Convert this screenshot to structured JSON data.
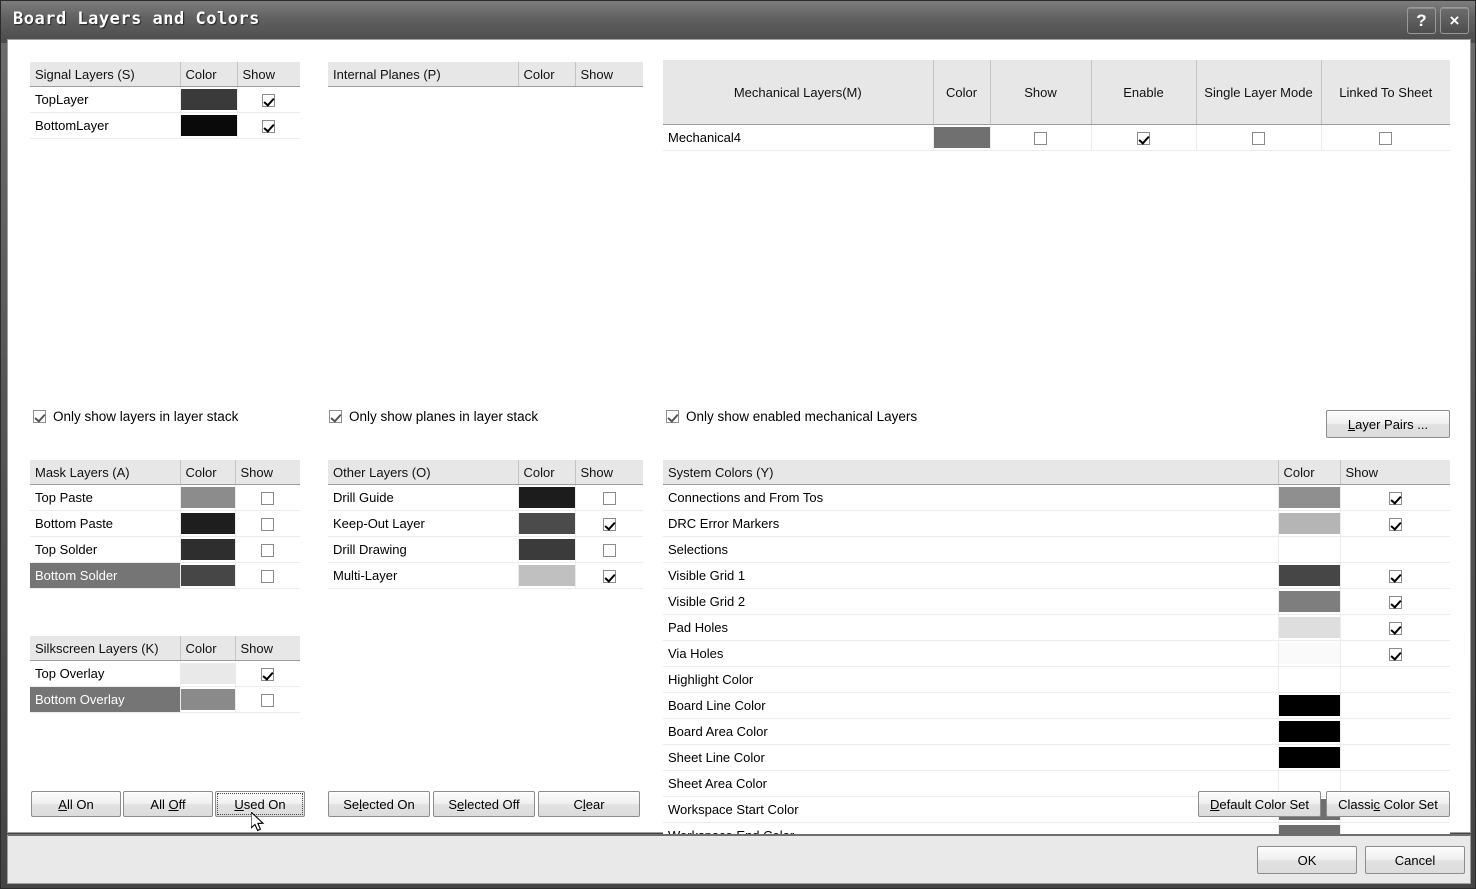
{
  "window": {
    "title": "Board Layers and Colors",
    "help_button": "?",
    "close_button": "×"
  },
  "signal_layers": {
    "headers": [
      "Signal Layers (S)",
      "Color",
      "Show"
    ],
    "rows": [
      {
        "name": "TopLayer",
        "color": "#3a3a3a",
        "show": true,
        "selected": false
      },
      {
        "name": "BottomLayer",
        "color": "#0a0a0a",
        "show": true,
        "selected": false
      }
    ]
  },
  "internal_planes": {
    "headers": [
      "Internal Planes (P)",
      "Color",
      "Show"
    ],
    "rows": []
  },
  "mechanical_layers": {
    "headers": [
      "Mechanical Layers(M)",
      "Color",
      "Show",
      "Enable",
      "Single Layer Mode",
      "Linked To Sheet"
    ],
    "rows": [
      {
        "name": "Mechanical4",
        "color": "#707070",
        "show": false,
        "enable": true,
        "single_layer_mode": false,
        "linked_to_sheet": false,
        "selected": false
      }
    ]
  },
  "options": {
    "only_show_layers": {
      "label": "Only show layers in layer stack",
      "checked": true
    },
    "only_show_planes": {
      "label": "Only show planes in layer stack",
      "checked": true
    },
    "only_show_mechanical": {
      "label": "Only show enabled mechanical Layers",
      "checked": true
    }
  },
  "mask_layers": {
    "headers": [
      "Mask Layers (A)",
      "Color",
      "Show"
    ],
    "rows": [
      {
        "name": "Top Paste",
        "color": "#8c8c8c",
        "show": false,
        "selected": false
      },
      {
        "name": "Bottom Paste",
        "color": "#1e1e1e",
        "show": false,
        "selected": false
      },
      {
        "name": "Top Solder",
        "color": "#2e2e2e",
        "show": false,
        "selected": false
      },
      {
        "name": "Bottom Solder",
        "color": "#464646",
        "show": false,
        "selected": true
      }
    ]
  },
  "other_layers": {
    "headers": [
      "Other Layers (O)",
      "Color",
      "Show"
    ],
    "rows": [
      {
        "name": "Drill Guide",
        "color": "#1c1c1c",
        "show": false,
        "selected": false
      },
      {
        "name": "Keep-Out Layer",
        "color": "#4b4b4b",
        "show": true,
        "selected": false
      },
      {
        "name": "Drill Drawing",
        "color": "#3b3b3b",
        "show": false,
        "selected": false
      },
      {
        "name": "Multi-Layer",
        "color": "#c0c0c0",
        "show": true,
        "selected": false
      }
    ]
  },
  "silkscreen_layers": {
    "headers": [
      "Silkscreen Layers (K)",
      "Color",
      "Show"
    ],
    "rows": [
      {
        "name": "Top Overlay",
        "color": "#e9e9e9",
        "show": true,
        "selected": false
      },
      {
        "name": "Bottom Overlay",
        "color": "#8a8a8a",
        "show": false,
        "selected": true
      }
    ]
  },
  "system_colors": {
    "headers": [
      "System Colors (Y)",
      "Color",
      "Show"
    ],
    "rows": [
      {
        "name": "Connections and From Tos",
        "color": "#8f8f8f",
        "show": true
      },
      {
        "name": "DRC Error Markers",
        "color": "#b5b5b5",
        "show": true
      },
      {
        "name": "Selections",
        "color": "",
        "show": null
      },
      {
        "name": "Visible Grid 1",
        "color": "#464646",
        "show": true
      },
      {
        "name": "Visible Grid 2",
        "color": "#7e7e7e",
        "show": true
      },
      {
        "name": "Pad Holes",
        "color": "#dedede",
        "show": true
      },
      {
        "name": "Via Holes",
        "color": "#fafafa",
        "show": true
      },
      {
        "name": "Highlight Color",
        "color": "",
        "show": null
      },
      {
        "name": "Board Line Color",
        "color": "#000000",
        "show": null
      },
      {
        "name": "Board Area Color",
        "color": "#000000",
        "show": null
      },
      {
        "name": "Sheet Line Color",
        "color": "#000000",
        "show": null
      },
      {
        "name": "Sheet Area Color",
        "color": "",
        "show": null
      },
      {
        "name": "Workspace Start Color",
        "color": "#6e6e6e",
        "show": null
      },
      {
        "name": "Workspace End Color",
        "color": "#6e6e6e",
        "show": null
      }
    ]
  },
  "buttons": {
    "layer_pairs": {
      "pre": "",
      "mn": "L",
      "post": "ayer Pairs ..."
    },
    "all_on": {
      "pre": "",
      "mn": "A",
      "post": "ll On"
    },
    "all_off": {
      "pre": "All ",
      "mn": "O",
      "post": "ff"
    },
    "used_on": {
      "pre": "",
      "mn": "U",
      "post": "sed On"
    },
    "selected_on": {
      "pre": "Se",
      "mn": "l",
      "post": "ected On"
    },
    "selected_off": {
      "pre": "S",
      "mn": "e",
      "post": "lected Off"
    },
    "clear": {
      "pre": "C",
      "mn": "l",
      "post": "ear"
    },
    "default_color_set": {
      "pre": "",
      "mn": "D",
      "post": "efault Color Set"
    },
    "classic_color_set": {
      "pre": "Classi",
      "mn": "c",
      "post": " Color Set"
    },
    "ok": {
      "pre": "OK",
      "mn": "",
      "post": ""
    },
    "cancel": {
      "pre": "Cancel",
      "mn": "",
      "post": ""
    }
  }
}
